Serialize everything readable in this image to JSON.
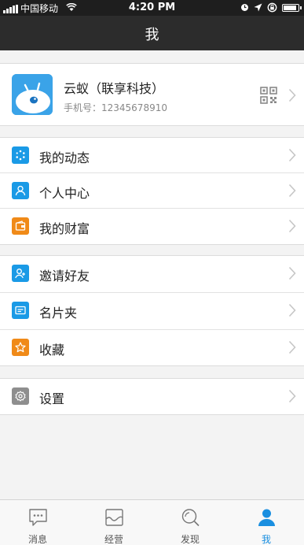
{
  "status_bar": {
    "carrier": "中国移动",
    "time": "4:20 PM"
  },
  "nav": {
    "title": "我"
  },
  "profile": {
    "name": "云蚁（联享科技）",
    "phone": "手机号：12345678910"
  },
  "menu_group_1": [
    {
      "label": "我的动态",
      "icon": "moments-icon",
      "color": "#1a9ae6"
    },
    {
      "label": "个人中心",
      "icon": "person-icon",
      "color": "#1a9ae6"
    },
    {
      "label": "我的财富",
      "icon": "wallet-icon",
      "color": "#f08a18"
    }
  ],
  "menu_group_2": [
    {
      "label": "邀请好友",
      "icon": "add-friend-icon",
      "color": "#1a9ae6"
    },
    {
      "label": "名片夹",
      "icon": "card-holder-icon",
      "color": "#1a9ae6"
    },
    {
      "label": "收藏",
      "icon": "star-icon",
      "color": "#f08a18"
    }
  ],
  "menu_group_3": [
    {
      "label": "设置",
      "icon": "gear-icon",
      "color": "#8e8e8e"
    }
  ],
  "tab_bar": [
    {
      "label": "消息",
      "icon": "message-icon",
      "active": false
    },
    {
      "label": "经营",
      "icon": "business-icon",
      "active": false
    },
    {
      "label": "发现",
      "icon": "search-icon",
      "active": false
    },
    {
      "label": "我",
      "icon": "me-icon",
      "active": true
    }
  ],
  "colors": {
    "accent": "#1a8fe0",
    "orange": "#f08a18",
    "navbar": "#2c2c2c"
  }
}
